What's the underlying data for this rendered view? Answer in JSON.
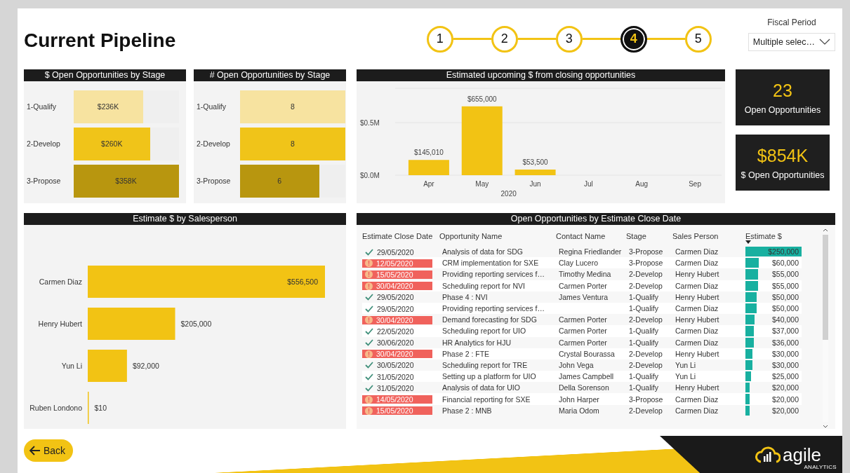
{
  "title": "Current Pipeline",
  "steps": [
    {
      "label": "1",
      "selected": false
    },
    {
      "label": "2",
      "selected": false
    },
    {
      "label": "3",
      "selected": false
    },
    {
      "label": "4",
      "selected": true
    },
    {
      "label": "5",
      "selected": false
    }
  ],
  "fiscal_period": {
    "label": "Fiscal Period",
    "value": "Multiple selec…"
  },
  "open_by_stage_amount": {
    "title": "$ Open Opportunities by Stage",
    "stages": [
      {
        "label": "1-Qualify",
        "value": "$236K",
        "level": 0.66
      },
      {
        "label": "2-Develop",
        "value": "$260K",
        "level": 0.73
      },
      {
        "label": "3-Propose",
        "value": "$358K",
        "level": 1
      }
    ]
  },
  "open_by_stage_count": {
    "title": "# Open Opportunities by Stage",
    "stages": [
      {
        "label": "1-Qualify",
        "value": "8",
        "level": 1
      },
      {
        "label": "2-Develop",
        "value": "8",
        "level": 1
      },
      {
        "label": "3-Propose",
        "value": "6",
        "level": 0.75
      }
    ]
  },
  "upcoming": {
    "title": "Estimated upcoming $ from closing opportunities",
    "chart_data": {
      "type": "bar",
      "categories": [
        "Apr",
        "May",
        "Jun",
        "Jul",
        "Aug",
        "Sep"
      ],
      "xlabel": "2020",
      "values": [
        145010,
        655000,
        53500,
        null,
        null,
        null
      ],
      "value_labels": [
        "$145,010",
        "$655,000",
        "$53,500",
        null,
        null,
        null
      ],
      "ylim": [
        0,
        826667
      ],
      "yticks": [
        {
          "value": 0,
          "label": "$0.0M"
        },
        {
          "value": 500000,
          "label": "$0.5M"
        }
      ]
    }
  },
  "kpis": [
    {
      "value": "23",
      "label": "Open Opportunities"
    },
    {
      "value": "$854K",
      "label": "$ Open Opportunities"
    }
  ],
  "by_salesperson": {
    "title": "Estimate $ by Salesperson",
    "chart_data": {
      "type": "bar",
      "orientation": "horizontal",
      "categories": [
        "Carmen Diaz",
        "Henry Hubert",
        "Yun Li",
        "Ruben Londono"
      ],
      "values": [
        556500,
        205000,
        92000,
        10
      ],
      "value_labels": [
        "$556,500",
        "$205,000",
        "$92,000",
        "$10"
      ]
    }
  },
  "table": {
    "title": "Open Opportunities by Estimate Close Date",
    "columns": [
      {
        "label": "Estimate Close Date",
        "sorted": false
      },
      {
        "label": "Opportunity Name",
        "sorted": false
      },
      {
        "label": "Contact Name",
        "sorted": false
      },
      {
        "label": "Stage",
        "sorted": false
      },
      {
        "label": "Sales Person",
        "sorted": false
      },
      {
        "label": "Estimate $",
        "sorted": true
      }
    ],
    "rows": [
      {
        "overdue": false,
        "close_date": "29/05/2020",
        "opportunity": "Analysis of data for SDG",
        "contact": "Regina Friedlander",
        "stage": "3-Propose",
        "sales_person": "Carmen Diaz",
        "estimate": "$250,000",
        "level": 1
      },
      {
        "overdue": true,
        "close_date": "12/05/2020",
        "opportunity": "CRM implementation  for SXE",
        "contact": "Clay Lucero",
        "stage": "3-Propose",
        "sales_person": "Carmen Diaz",
        "estimate": "$60,000",
        "level": 0.24
      },
      {
        "overdue": true,
        "close_date": "15/05/2020",
        "opportunity": "Providing reporting services f…",
        "contact": "Timothy Medina",
        "stage": "2-Develop",
        "sales_person": "Henry Hubert",
        "estimate": "$55,000",
        "level": 0.22
      },
      {
        "overdue": true,
        "close_date": "30/04/2020",
        "opportunity": "Scheduling report for NVI",
        "contact": "Carmen Porter",
        "stage": "2-Develop",
        "sales_person": "Carmen Diaz",
        "estimate": "$55,000",
        "level": 0.22
      },
      {
        "overdue": false,
        "close_date": "29/05/2020",
        "opportunity": "Phase 4 : NVI",
        "contact": "James Ventura",
        "stage": "1-Qualify",
        "sales_person": "Henry Hubert",
        "estimate": "$50,000",
        "level": 0.2
      },
      {
        "overdue": false,
        "close_date": "29/05/2020",
        "opportunity": "Providing reporting services f…",
        "stage": "1-Qualify",
        "sales_person": "Carmen Diaz",
        "estimate": "$50,000",
        "level": 0.2
      },
      {
        "overdue": true,
        "close_date": "30/04/2020",
        "opportunity": "Demand forecasting for SDG",
        "contact": "Carmen Porter",
        "stage": "2-Develop",
        "sales_person": "Henry Hubert",
        "estimate": "$40,000",
        "level": 0.16
      },
      {
        "overdue": false,
        "close_date": "22/05/2020",
        "opportunity": "Scheduling report for UIO",
        "contact": "Carmen Porter",
        "stage": "1-Qualify",
        "sales_person": "Carmen Diaz",
        "estimate": "$37,000",
        "level": 0.148
      },
      {
        "overdue": false,
        "close_date": "30/06/2020",
        "opportunity": "HR Analytics  for HJU",
        "contact": "Carmen Porter",
        "stage": "1-Qualify",
        "sales_person": "Carmen Diaz",
        "estimate": "$36,000",
        "level": 0.144
      },
      {
        "overdue": true,
        "close_date": "30/04/2020",
        "opportunity": "Phase 2 : FTE",
        "contact": "Crystal Bourassa",
        "stage": "2-Develop",
        "sales_person": "Henry Hubert",
        "estimate": "$30,000",
        "level": 0.12
      },
      {
        "overdue": false,
        "close_date": "30/05/2020",
        "opportunity": "Scheduling report for TRE",
        "contact": "John Vega",
        "stage": "2-Develop",
        "sales_person": "Yun Li",
        "estimate": "$30,000",
        "level": 0.12
      },
      {
        "overdue": false,
        "close_date": "31/05/2020",
        "opportunity": "Setting up a platform for UIO",
        "contact": "James Campbell",
        "stage": "1-Qualify",
        "sales_person": "Yun Li",
        "estimate": "$25,000",
        "level": 0.1
      },
      {
        "overdue": false,
        "close_date": "31/05/2020",
        "opportunity": "Analysis of data for UIO",
        "contact": "Della Sorenson",
        "stage": "1-Qualify",
        "sales_person": "Henry Hubert",
        "estimate": "$20,000",
        "level": 0.08
      },
      {
        "overdue": true,
        "close_date": "14/05/2020",
        "opportunity": "Financial reporting for SXE",
        "contact": "John Harper",
        "stage": "3-Propose",
        "sales_person": "Carmen Diaz",
        "estimate": "$20,000",
        "level": 0.08
      },
      {
        "overdue": true,
        "close_date": "15/05/2020",
        "opportunity": "Phase 2 : MNB",
        "contact": "Maria Odom",
        "stage": "2-Develop",
        "sales_person": "Carmen Diaz",
        "estimate": "$20,000",
        "level": 0.08
      }
    ]
  },
  "back": "Back",
  "logo": {
    "name": "agile",
    "tagline": "ANALYTICS"
  }
}
